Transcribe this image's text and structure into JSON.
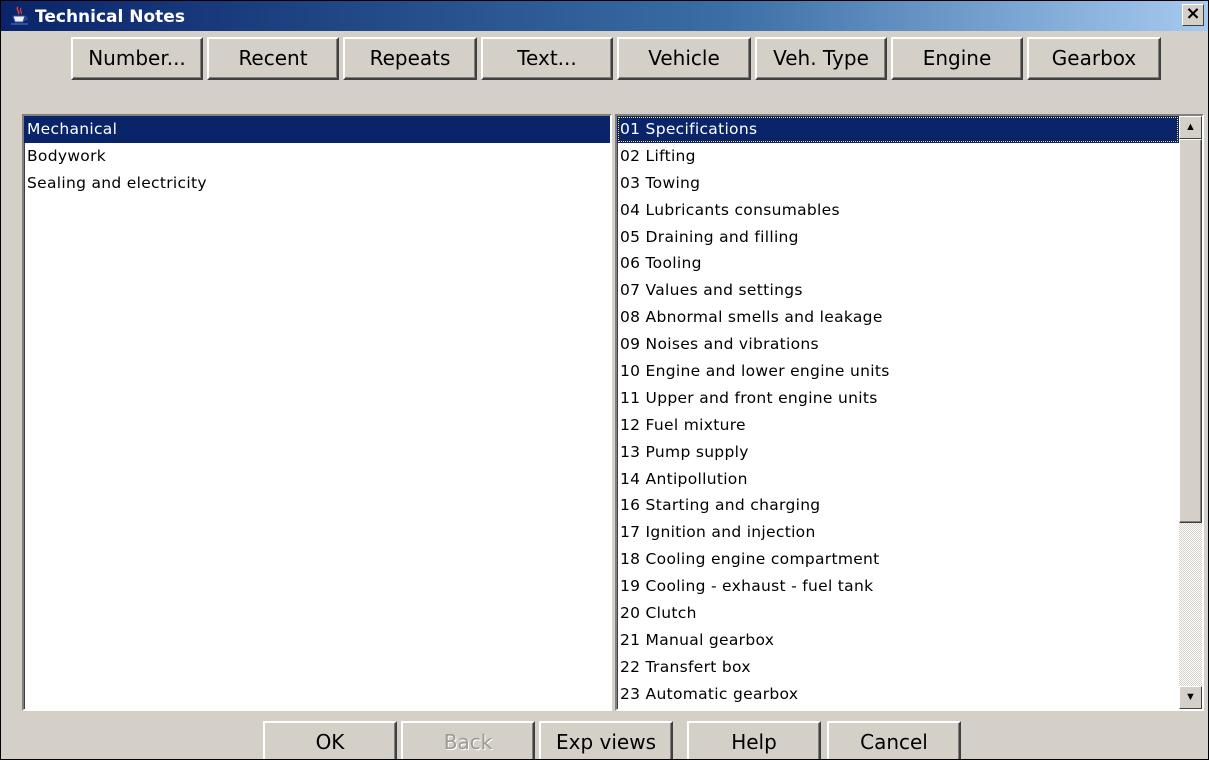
{
  "window": {
    "title": "Technical Notes",
    "close_glyph": "×"
  },
  "toolbar": {
    "buttons": [
      "Number...",
      "Recent",
      "Repeats",
      "Text...",
      "Vehicle",
      "Veh. Type",
      "Engine",
      "Gearbox"
    ]
  },
  "left_list": {
    "items": [
      "Mechanical",
      "Bodywork",
      "Sealing and electricity"
    ],
    "selected_index": 0
  },
  "right_list": {
    "items": [
      "01 Specifications",
      "02 Lifting",
      "03 Towing",
      "04 Lubricants consumables",
      "05 Draining and filling",
      "06 Tooling",
      "07 Values and settings",
      "08 Abnormal smells and leakage",
      "09 Noises and vibrations",
      "10 Engine and lower engine units",
      "11 Upper and front engine units",
      "12 Fuel mixture",
      "13 Pump supply",
      "14 Antipollution",
      "16 Starting and charging",
      "17 Ignition and injection",
      "18 Cooling engine compartment",
      "19 Cooling - exhaust - fuel tank",
      "20 Clutch",
      "21 Manual gearbox",
      "22 Transfert box",
      "23 Automatic gearbox"
    ],
    "selected_index": 0
  },
  "scrollbar": {
    "up_arrow": "▲",
    "down_arrow": "▼"
  },
  "bottom_buttons": {
    "ok": "OK",
    "back": "Back",
    "exp_views": "Exp views",
    "help": "Help",
    "cancel": "Cancel"
  },
  "icons": {
    "title": "java-coffee-cup-icon"
  },
  "colors": {
    "title_bar": "#0a246a",
    "selection": "#0a246a",
    "face": "#d4d0c8"
  }
}
